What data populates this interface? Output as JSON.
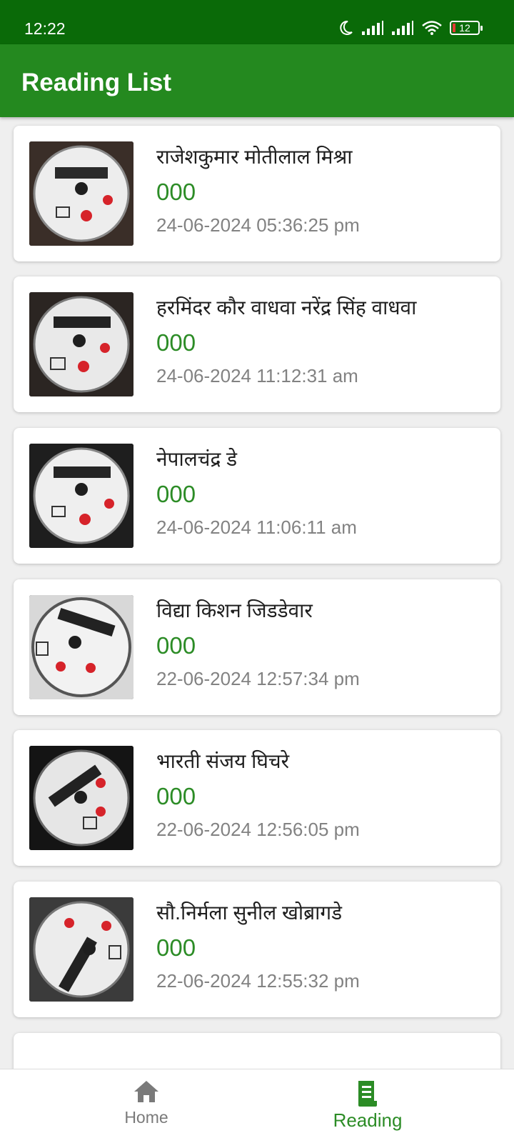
{
  "status_bar": {
    "time": "12:22",
    "battery": "12",
    "icons": [
      "moon-icon",
      "signal-icon",
      "signal-icon",
      "wifi-icon",
      "battery-icon"
    ]
  },
  "app_bar": {
    "title": "Reading List"
  },
  "colors": {
    "status_bar": "#0a6a08",
    "app_bar": "#24891f",
    "accent": "#2c8c26"
  },
  "readings": [
    {
      "name": "राजेशकुमार  मोतीलाल  मिश्रा",
      "reading": "000",
      "datetime": "24-06-2024 05:36:25 pm"
    },
    {
      "name": "हरमिंदर कौर वाधवा   नरेंद्र सिंह वाधवा",
      "reading": "000",
      "datetime": "24-06-2024 11:12:31 am"
    },
    {
      "name": "नेपालचंद्र   डे",
      "reading": "000",
      "datetime": "24-06-2024 11:06:11 am"
    },
    {
      "name": "विद्या  किशन  जिडडेवार",
      "reading": "000",
      "datetime": "22-06-2024 12:57:34 pm"
    },
    {
      "name": "भारती  संजय  घिचरे",
      "reading": "000",
      "datetime": "22-06-2024 12:56:05 pm"
    },
    {
      "name": " सौ.निर्मला  सुनील   खोब्रागडे",
      "reading": "000",
      "datetime": "22-06-2024 12:55:32 pm"
    }
  ],
  "bottom_nav": {
    "home_label": "Home",
    "reading_label": "Reading"
  }
}
